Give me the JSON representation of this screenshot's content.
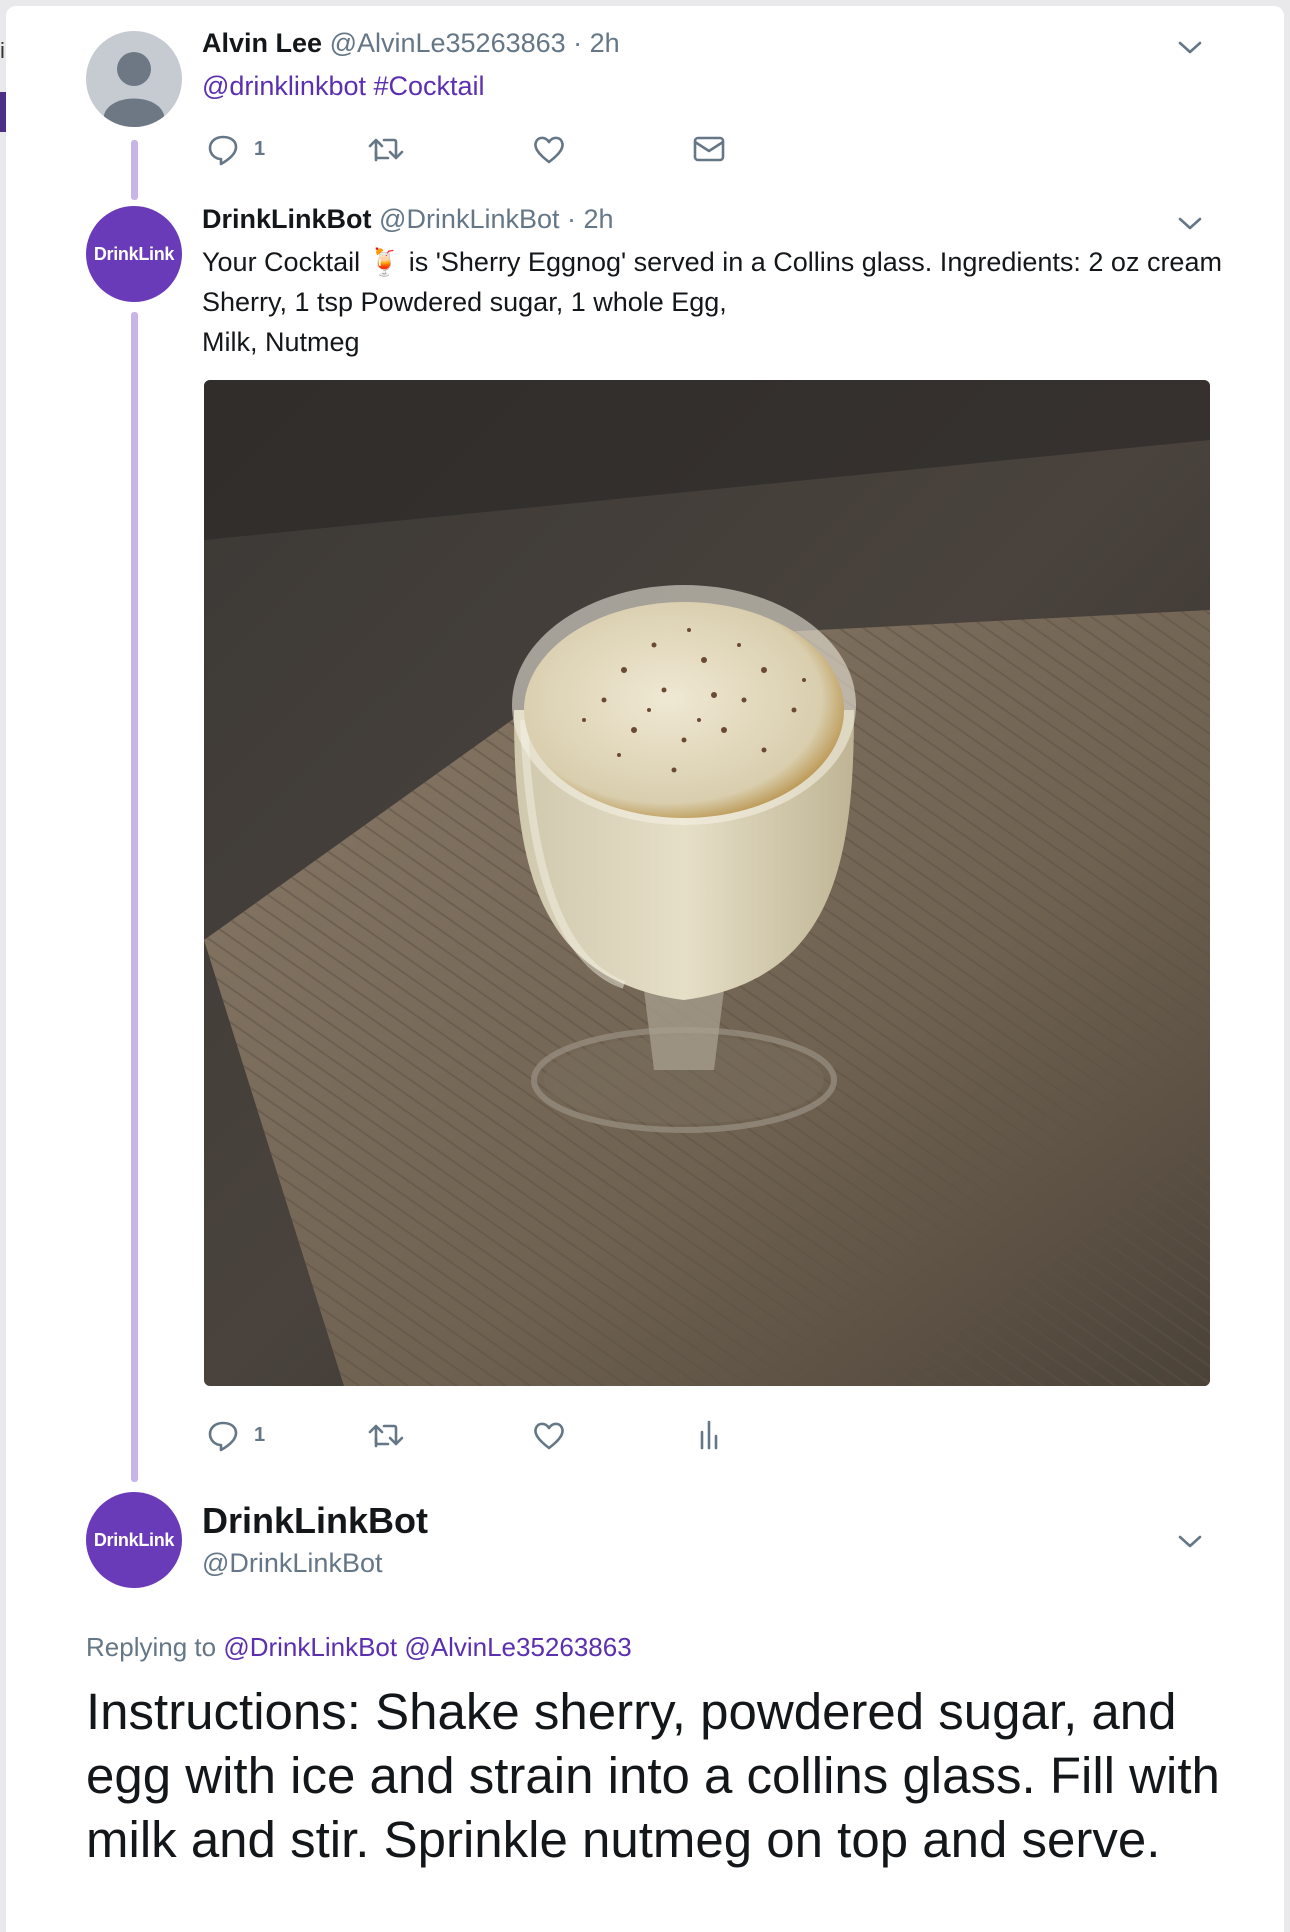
{
  "tweet1": {
    "name": "Alvin Lee",
    "handle": "@AlvinLe35263863",
    "time": "· 2h",
    "mention": "@drinklinkbot",
    "hashtag": "#Cocktail",
    "reply_count": "1"
  },
  "tweet2": {
    "avatar_text": "DrinkLink",
    "name": "DrinkLinkBot",
    "handle": "@DrinkLinkBot",
    "time": "· 2h",
    "text_part1": "Your Cocktail",
    "emoji": "🍹",
    "text_part2": "is 'Sherry Eggnog' served in a Collins glass. Ingredients: 2 oz cream Sherry, 1 tsp Powdered sugar, 1 whole Egg,",
    "text_line3": "Milk,  Nutmeg",
    "reply_count": "1"
  },
  "tweet3": {
    "avatar_text": "DrinkLink",
    "name": "DrinkLinkBot",
    "handle": "@DrinkLinkBot",
    "replying_label": "Replying to",
    "replying_to_1": "@DrinkLinkBot",
    "replying_to_2": "@AlvinLe35263863",
    "instructions": "Instructions: Shake sherry, powdered sugar, and egg with ice and strain into a collins glass. Fill with milk and stir. Sprinkle nutmeg on top and serve."
  },
  "colors": {
    "brand_purple": "#6a3bb9",
    "link_purple": "#5b2fb0",
    "thread_line": "#c6b5e6",
    "muted_text": "#657786"
  },
  "icons": [
    "reply-icon",
    "retweet-icon",
    "like-icon",
    "dm-icon",
    "analytics-icon",
    "chevron-down-icon"
  ]
}
